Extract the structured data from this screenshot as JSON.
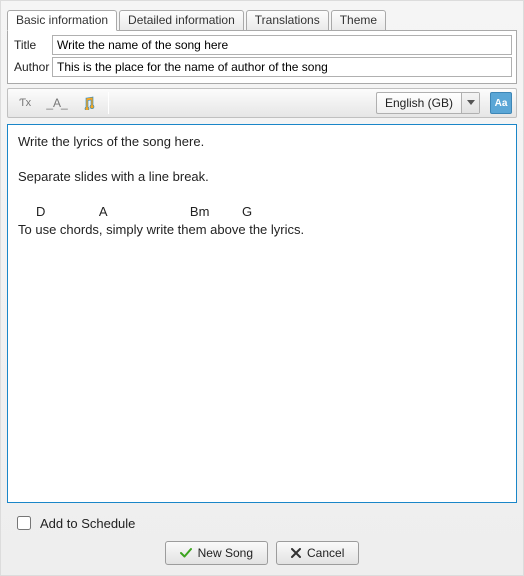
{
  "tabs": {
    "basic": "Basic information",
    "detailed": "Detailed information",
    "translations": "Translations",
    "theme": "Theme"
  },
  "fields": {
    "title_label": "Title",
    "title_value": "Write the name of the song here",
    "author_label": "Author",
    "author_value": "This is the place for the name of author of the song"
  },
  "toolbar": {
    "chord_panel_text": "Ƭx",
    "section_panel_text": "_A_",
    "language_label": "English (GB)",
    "aa_label": "Aa"
  },
  "lyrics_text": "Write the lyrics of the song here.\n\nSeparate slides with a line break.\n\n     D               A                       Bm         G\nTo use chords, simply write them above the lyrics.",
  "footer": {
    "add_to_schedule": "Add to Schedule",
    "new_song": "New Song",
    "cancel": "Cancel"
  }
}
